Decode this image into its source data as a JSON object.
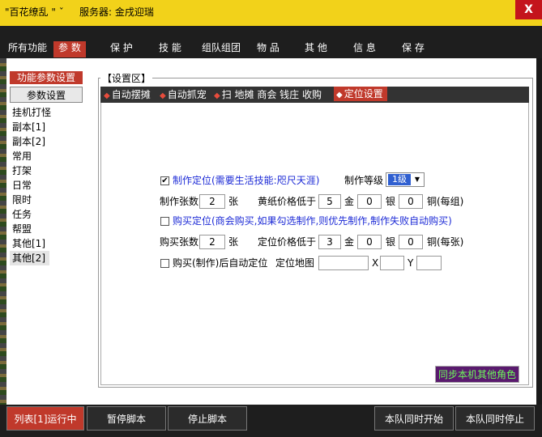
{
  "window": {
    "title": "\"百花缭乱 \"",
    "title_suffix": "ˇ",
    "server_label": "服务器: 金戌迎瑞",
    "close_glyph": "X"
  },
  "menu": {
    "items": [
      {
        "label": "所有功能"
      },
      {
        "label": "参 数",
        "active": true
      },
      {
        "label": "保 护"
      },
      {
        "label": "技 能"
      },
      {
        "label": "组队组团"
      },
      {
        "label": "物 品"
      },
      {
        "label": "其 他"
      },
      {
        "label": "信 息"
      },
      {
        "label": "保 存"
      }
    ]
  },
  "left_panel": {
    "header": "功能参数设置",
    "button": "参数设置",
    "items": [
      "挂机打怪",
      "副本[1]",
      "副本[2]",
      "常用",
      "打架",
      "日常",
      "限时",
      "任务",
      "帮盟",
      "其他[1]",
      "其他[2]"
    ],
    "selected": "其他[2]"
  },
  "settings": {
    "group_label": "【设置区】",
    "subtabs": [
      {
        "label": "自动摆摊"
      },
      {
        "label": "自动抓宠"
      },
      {
        "label": "扫 地摊 商会 钱庄 收购"
      },
      {
        "label": "定位设置",
        "active": true
      }
    ],
    "form": {
      "make_locate": {
        "checked": true,
        "label": "制作定位(需要生活技能:咫尺天涯)"
      },
      "make_level": {
        "label": "制作等级",
        "value": "1级",
        "options_icon": "chevron-down-icon"
      },
      "make_count": {
        "label": "制作张数",
        "value": "2",
        "unit": "张"
      },
      "yellow_paper": {
        "label": "黄纸价格低于",
        "gold": "5",
        "gold_unit": "金",
        "silver": "0",
        "silver_unit": "银",
        "copper": "0",
        "copper_unit": "铜(每组)"
      },
      "buy_locate": {
        "checked": false,
        "label": "购买定位(商会购买,如果勾选制作,则优先制作,制作失败自动购买)"
      },
      "buy_count": {
        "label": "购买张数",
        "value": "2",
        "unit": "张"
      },
      "locate_price": {
        "label": "定位价格低于",
        "gold": "3",
        "gold_unit": "金",
        "silver": "0",
        "silver_unit": "银",
        "copper": "0",
        "copper_unit": "铜(每张)"
      },
      "auto_locate": {
        "checked": false,
        "label": "购买(制作)后自动定位",
        "map_label": "定位地图",
        "map_value": "",
        "x_label": "X",
        "x_value": "",
        "y_label": "Y",
        "y_value": ""
      }
    },
    "sync_button": "同步本机其他角色"
  },
  "bottom": {
    "run_status": "列表[1]运行中",
    "pause": "暂停脚本",
    "stop": "停止脚本",
    "team_start": "本队同时开始",
    "team_stop": "本队同时停止"
  },
  "colors": {
    "titlebar": "#f2d21a",
    "accent_red": "#c0392b",
    "dark_bar": "#1e1e1e",
    "link_blue": "#1d2bd6",
    "sync_bg": "#5a1a6e",
    "sync_text": "#6dfa5a"
  }
}
